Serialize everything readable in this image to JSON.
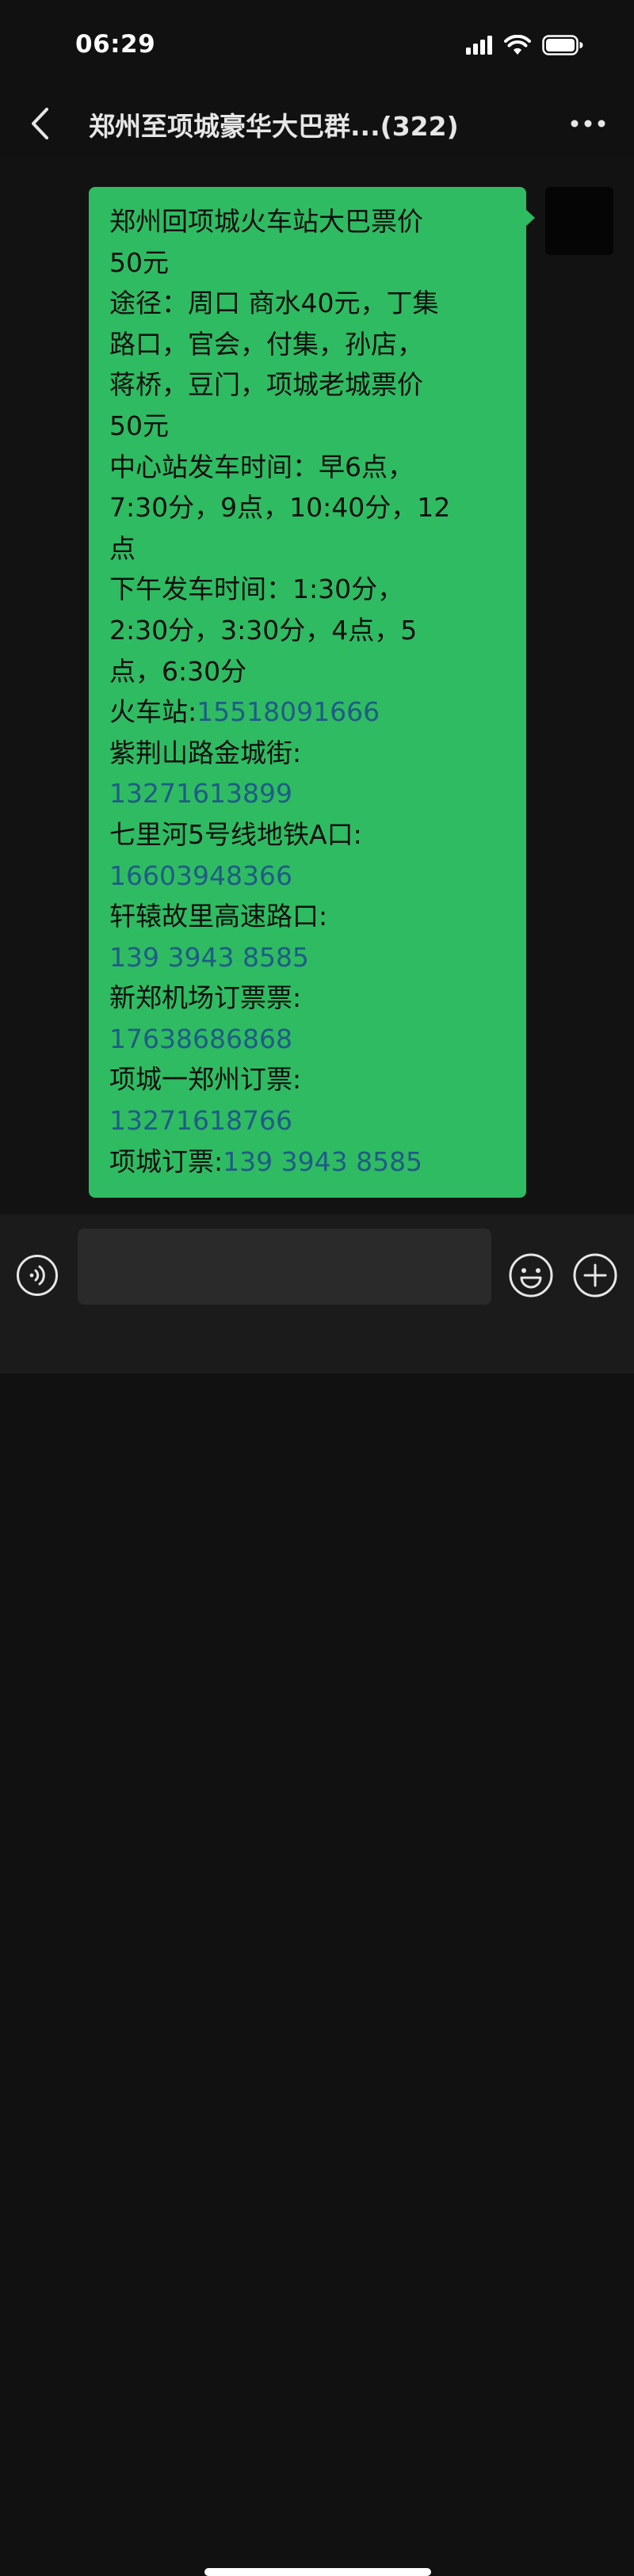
{
  "status_bar": {
    "time": "06:29",
    "icons": [
      "signal-icon",
      "wifi-icon",
      "battery-icon"
    ]
  },
  "header": {
    "title": "郑州至项城豪华大巴群...",
    "member_count": "(322)",
    "back_icon": "chevron-left-icon",
    "more_icon": "more-dots-icon"
  },
  "message": {
    "lines": [
      {
        "text": "郑州回项城火车站大巴票价"
      },
      {
        "text": "50元"
      },
      {
        "text": "途径：周口 商水40元，丁集"
      },
      {
        "text": "路口，官会，付集，孙店，"
      },
      {
        "text": "蒋桥，豆门，项城老城票价"
      },
      {
        "text": "50元"
      },
      {
        "text": "中心站发车时间：早6点，"
      },
      {
        "text": "7:30分，9点，10:40分，12"
      },
      {
        "text": "点"
      },
      {
        "text": "下午发车时间：1:30分，"
      },
      {
        "text": "2:30分，3:30分，4点，5"
      },
      {
        "text": "点，6:30分"
      },
      {
        "text": "火车站:",
        "phone": "15518091666"
      },
      {
        "text": "紫荆山路金城街:"
      },
      {
        "text": "",
        "phone": "13271613899"
      },
      {
        "text": "七里河5号线地铁A口:"
      },
      {
        "text": "",
        "phone": "16603948366"
      },
      {
        "text": "轩辕故里高速路口:"
      },
      {
        "text": "",
        "phone": "139 3943 8585"
      },
      {
        "text": "新郑机场订票票:"
      },
      {
        "text": "",
        "phone": "17638686868"
      },
      {
        "text": "项城一郑州订票:"
      },
      {
        "text": "",
        "phone": "13271618766"
      },
      {
        "text": "项城订票:",
        "phone": "139 3943 8585"
      }
    ]
  },
  "input_bar": {
    "voice_icon": "voice-icon",
    "input_placeholder": "",
    "emoji_icon": "emoji-icon",
    "plus_icon": "plus-icon"
  },
  "colors": {
    "bubble": "#2fbb62",
    "phone_link": "#1f5c86",
    "background": "#111111"
  }
}
